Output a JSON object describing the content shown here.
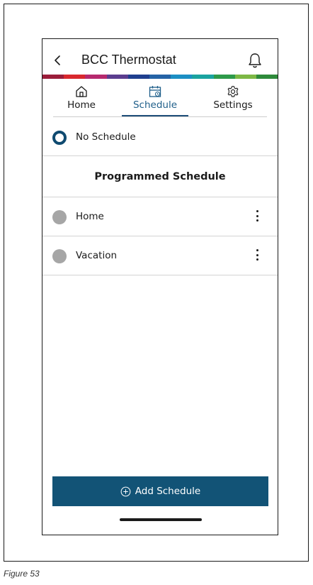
{
  "header": {
    "title": "BCC Thermostat",
    "back_icon": "chevron-left-icon",
    "notification_icon": "bell-icon"
  },
  "brand_strip_colors": [
    "#9b1d3a",
    "#d9282e",
    "#b6296e",
    "#5b3d8f",
    "#1f3f8f",
    "#2563a6",
    "#1c8fc4",
    "#1aa3a0",
    "#2e9a4a",
    "#7db845",
    "#2e8a3a"
  ],
  "tabs": [
    {
      "label": "Home",
      "icon": "home-icon",
      "active": false
    },
    {
      "label": "Schedule",
      "icon": "calendar-icon",
      "active": true
    },
    {
      "label": "Settings",
      "icon": "gear-icon",
      "active": false
    }
  ],
  "no_schedule": {
    "label": "No Schedule",
    "selected": true
  },
  "section_title": "Programmed Schedule",
  "schedules": [
    {
      "label": "Home",
      "selected": false,
      "menu_icon": "more-vertical-icon"
    },
    {
      "label": "Vacation",
      "selected": false,
      "menu_icon": "more-vertical-icon"
    }
  ],
  "add_button": {
    "label": "Add Schedule",
    "icon": "plus-circle-icon"
  },
  "colors": {
    "accent": "#125376",
    "active_tab": "#1f5f8a",
    "inactive_radio": "#a6a6a6"
  },
  "caption": "Figure 53"
}
